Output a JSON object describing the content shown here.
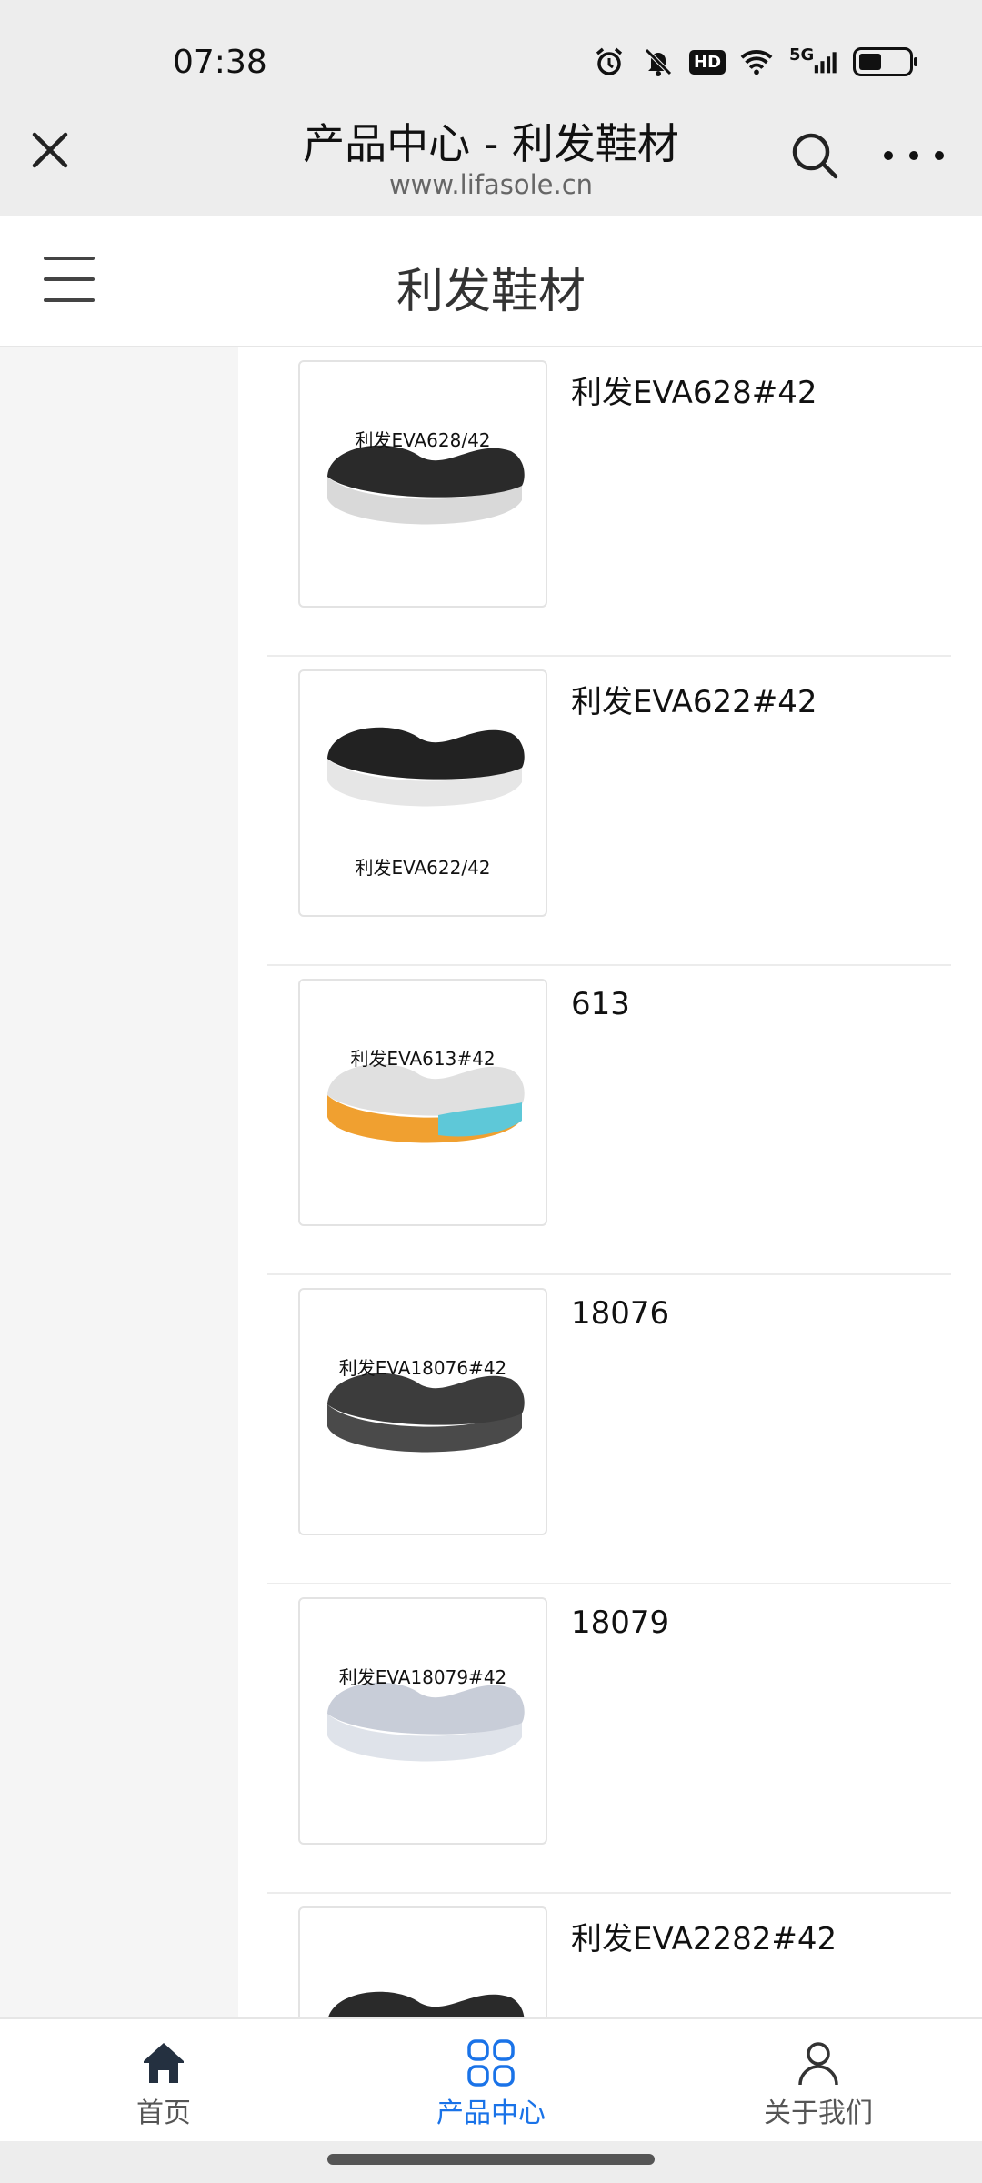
{
  "status_bar": {
    "time": "07:38",
    "icons": [
      "alarm-icon",
      "mute-icon",
      "hd-icon",
      "wifi-icon",
      "5g-signal-icon",
      "battery-icon"
    ],
    "hd_label": "HD",
    "network_label": "5G",
    "battery_level": 0.45
  },
  "browser": {
    "title": "产品中心 - 利发鞋材",
    "url": "www.lifasole.cn"
  },
  "site": {
    "title": "利发鞋材"
  },
  "products": [
    {
      "title": "利发EVA628#42",
      "image_caption": "利发EVA628/42",
      "caption_pos": "top",
      "sole_color": "#2a2a2a",
      "base_color": "#d9d9d9"
    },
    {
      "title": "利发EVA622#42",
      "image_caption": "利发EVA622/42",
      "caption_pos": "bottom",
      "sole_color": "#222222",
      "base_color": "#e6e6e6"
    },
    {
      "title": "613",
      "image_caption": "利发EVA613#42",
      "caption_pos": "top",
      "sole_color": "#e0e0e0",
      "base_color": "#f0a030",
      "accent_color": "#5ec8d8"
    },
    {
      "title": "18076",
      "image_caption": "利发EVA18076#42",
      "caption_pos": "top",
      "sole_color": "#3c3c3c",
      "base_color": "#4a4a4a"
    },
    {
      "title": "18079",
      "image_caption": "利发EVA18079#42",
      "caption_pos": "top",
      "sole_color": "#c8cdd8",
      "base_color": "#dfe3ea"
    },
    {
      "title": "利发EVA2282#42",
      "image_caption": "",
      "caption_pos": "top",
      "sole_color": "#2a2a2a",
      "base_color": "#e8e8e0"
    }
  ],
  "bottom_nav": {
    "items": [
      {
        "label": "首页",
        "icon": "home-icon",
        "active": false
      },
      {
        "label": "产品中心",
        "icon": "grid-icon",
        "active": true
      },
      {
        "label": "关于我们",
        "icon": "user-icon",
        "active": false
      }
    ]
  },
  "colors": {
    "accent": "#1a73e8",
    "header_bg": "#ededed"
  }
}
